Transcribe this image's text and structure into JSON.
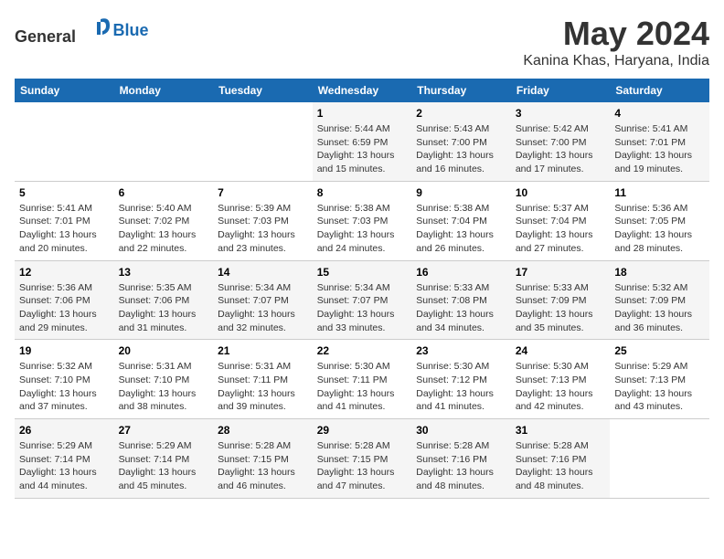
{
  "header": {
    "logo_general": "General",
    "logo_blue": "Blue",
    "title": "May 2024",
    "subtitle": "Kanina Khas, Haryana, India"
  },
  "weekdays": [
    "Sunday",
    "Monday",
    "Tuesday",
    "Wednesday",
    "Thursday",
    "Friday",
    "Saturday"
  ],
  "weeks": [
    [
      {
        "day": "",
        "info": ""
      },
      {
        "day": "",
        "info": ""
      },
      {
        "day": "",
        "info": ""
      },
      {
        "day": "1",
        "info": "Sunrise: 5:44 AM\nSunset: 6:59 PM\nDaylight: 13 hours and 15 minutes."
      },
      {
        "day": "2",
        "info": "Sunrise: 5:43 AM\nSunset: 7:00 PM\nDaylight: 13 hours and 16 minutes."
      },
      {
        "day": "3",
        "info": "Sunrise: 5:42 AM\nSunset: 7:00 PM\nDaylight: 13 hours and 17 minutes."
      },
      {
        "day": "4",
        "info": "Sunrise: 5:41 AM\nSunset: 7:01 PM\nDaylight: 13 hours and 19 minutes."
      }
    ],
    [
      {
        "day": "5",
        "info": "Sunrise: 5:41 AM\nSunset: 7:01 PM\nDaylight: 13 hours and 20 minutes."
      },
      {
        "day": "6",
        "info": "Sunrise: 5:40 AM\nSunset: 7:02 PM\nDaylight: 13 hours and 22 minutes."
      },
      {
        "day": "7",
        "info": "Sunrise: 5:39 AM\nSunset: 7:03 PM\nDaylight: 13 hours and 23 minutes."
      },
      {
        "day": "8",
        "info": "Sunrise: 5:38 AM\nSunset: 7:03 PM\nDaylight: 13 hours and 24 minutes."
      },
      {
        "day": "9",
        "info": "Sunrise: 5:38 AM\nSunset: 7:04 PM\nDaylight: 13 hours and 26 minutes."
      },
      {
        "day": "10",
        "info": "Sunrise: 5:37 AM\nSunset: 7:04 PM\nDaylight: 13 hours and 27 minutes."
      },
      {
        "day": "11",
        "info": "Sunrise: 5:36 AM\nSunset: 7:05 PM\nDaylight: 13 hours and 28 minutes."
      }
    ],
    [
      {
        "day": "12",
        "info": "Sunrise: 5:36 AM\nSunset: 7:06 PM\nDaylight: 13 hours and 29 minutes."
      },
      {
        "day": "13",
        "info": "Sunrise: 5:35 AM\nSunset: 7:06 PM\nDaylight: 13 hours and 31 minutes."
      },
      {
        "day": "14",
        "info": "Sunrise: 5:34 AM\nSunset: 7:07 PM\nDaylight: 13 hours and 32 minutes."
      },
      {
        "day": "15",
        "info": "Sunrise: 5:34 AM\nSunset: 7:07 PM\nDaylight: 13 hours and 33 minutes."
      },
      {
        "day": "16",
        "info": "Sunrise: 5:33 AM\nSunset: 7:08 PM\nDaylight: 13 hours and 34 minutes."
      },
      {
        "day": "17",
        "info": "Sunrise: 5:33 AM\nSunset: 7:09 PM\nDaylight: 13 hours and 35 minutes."
      },
      {
        "day": "18",
        "info": "Sunrise: 5:32 AM\nSunset: 7:09 PM\nDaylight: 13 hours and 36 minutes."
      }
    ],
    [
      {
        "day": "19",
        "info": "Sunrise: 5:32 AM\nSunset: 7:10 PM\nDaylight: 13 hours and 37 minutes."
      },
      {
        "day": "20",
        "info": "Sunrise: 5:31 AM\nSunset: 7:10 PM\nDaylight: 13 hours and 38 minutes."
      },
      {
        "day": "21",
        "info": "Sunrise: 5:31 AM\nSunset: 7:11 PM\nDaylight: 13 hours and 39 minutes."
      },
      {
        "day": "22",
        "info": "Sunrise: 5:30 AM\nSunset: 7:11 PM\nDaylight: 13 hours and 41 minutes."
      },
      {
        "day": "23",
        "info": "Sunrise: 5:30 AM\nSunset: 7:12 PM\nDaylight: 13 hours and 41 minutes."
      },
      {
        "day": "24",
        "info": "Sunrise: 5:30 AM\nSunset: 7:13 PM\nDaylight: 13 hours and 42 minutes."
      },
      {
        "day": "25",
        "info": "Sunrise: 5:29 AM\nSunset: 7:13 PM\nDaylight: 13 hours and 43 minutes."
      }
    ],
    [
      {
        "day": "26",
        "info": "Sunrise: 5:29 AM\nSunset: 7:14 PM\nDaylight: 13 hours and 44 minutes."
      },
      {
        "day": "27",
        "info": "Sunrise: 5:29 AM\nSunset: 7:14 PM\nDaylight: 13 hours and 45 minutes."
      },
      {
        "day": "28",
        "info": "Sunrise: 5:28 AM\nSunset: 7:15 PM\nDaylight: 13 hours and 46 minutes."
      },
      {
        "day": "29",
        "info": "Sunrise: 5:28 AM\nSunset: 7:15 PM\nDaylight: 13 hours and 47 minutes."
      },
      {
        "day": "30",
        "info": "Sunrise: 5:28 AM\nSunset: 7:16 PM\nDaylight: 13 hours and 48 minutes."
      },
      {
        "day": "31",
        "info": "Sunrise: 5:28 AM\nSunset: 7:16 PM\nDaylight: 13 hours and 48 minutes."
      },
      {
        "day": "",
        "info": ""
      }
    ]
  ]
}
